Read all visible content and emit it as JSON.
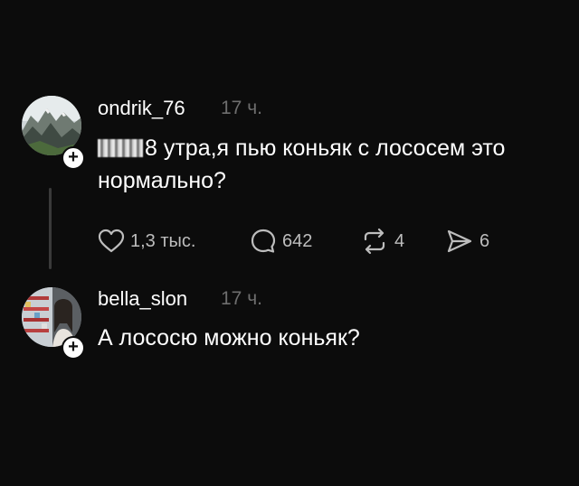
{
  "comments": [
    {
      "username": "ondrik_76",
      "time": "17 ч.",
      "text_line1": "8 утра,я пью коньяк  с лососем это",
      "text_line2": "нормально?",
      "avatar_icon": "mountain-landscape-avatar",
      "actions": {
        "likes": "1,3 тыс.",
        "replies": "642",
        "reposts": "4",
        "shares": "6"
      }
    },
    {
      "username": "bella_slon",
      "time": "17 ч.",
      "text_line1": "А лососю можно коньяк?",
      "avatar_icon": "store-shelf-selfie-avatar"
    }
  ],
  "follow_symbol": "+",
  "colors": {
    "background": "#0c0c0c",
    "text": "#ffffff",
    "muted": "#6e6e6e",
    "icon": "#bdbdbd"
  }
}
